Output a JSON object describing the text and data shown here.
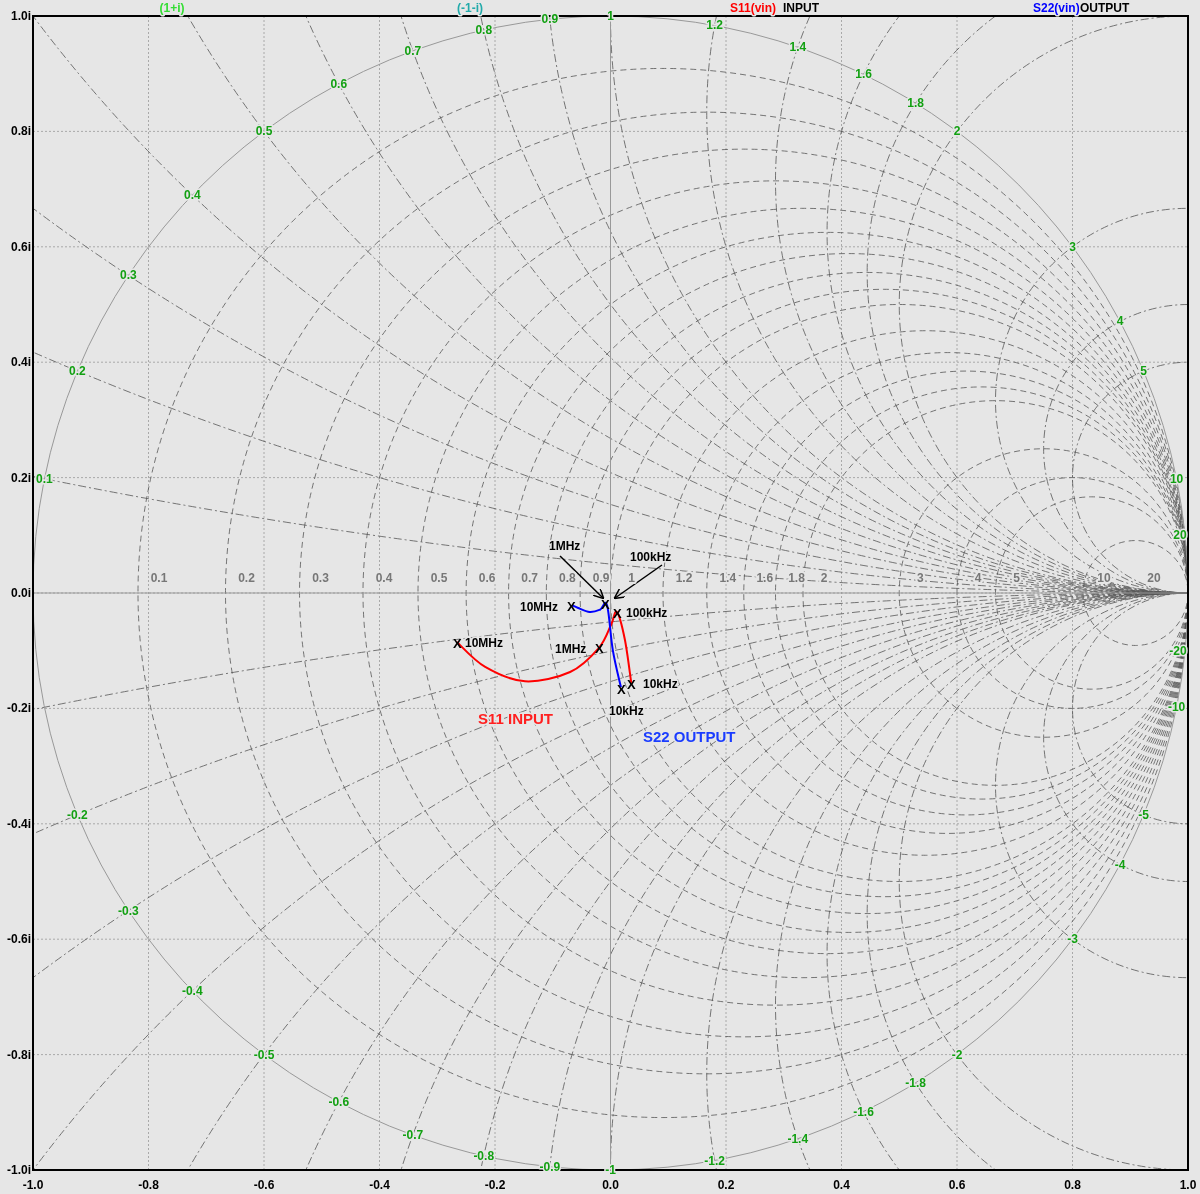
{
  "plot": {
    "reference_labels": [
      {
        "text": "(1+i)",
        "color": "#33dd33"
      },
      {
        "text": "(-1-i)",
        "color": "#22aaaa"
      }
    ],
    "legend": [
      {
        "label": "INPUT"
      },
      {
        "label": "OUTPUT"
      }
    ],
    "reactance_labels_upper": [
      "0.1",
      "0.2",
      "0.3",
      "0.4",
      "0.5",
      "0.6",
      "0.7",
      "0.8",
      "0.9",
      "1",
      "1.2",
      "1.4",
      "1.6",
      "1.8",
      "2",
      "3",
      "4",
      "5",
      "10",
      "20"
    ],
    "reactance_labels_lower": [
      "-0.2",
      "-0.3",
      "-0.4",
      "-0.5",
      "-0.6",
      "-0.7",
      "-0.8",
      "-0.9",
      "-1",
      "-1.2",
      "-1.4",
      "-1.6",
      "-1.8",
      "-2",
      "-3",
      "-4",
      "-5",
      "-10",
      "-20"
    ],
    "resistance_labels": [
      "0.1",
      "0.2",
      "0.3",
      "0.4",
      "0.5",
      "0.6",
      "0.7",
      "0.8",
      "0.9",
      "1",
      "1.2",
      "1.4",
      "1.6",
      "1.8",
      "2",
      "3",
      "4",
      "5",
      "10",
      "20"
    ],
    "chart_data": {
      "type": "line",
      "grid": true,
      "xlim": [
        -1,
        1
      ],
      "ylim": [
        -1,
        1
      ],
      "xticks": [
        {
          "value": -1,
          "label": "-1.0"
        },
        {
          "value": -0.8,
          "label": "-0.8"
        },
        {
          "value": -0.6,
          "label": "-0.6"
        },
        {
          "value": -0.4,
          "label": "-0.4"
        },
        {
          "value": -0.2,
          "label": "-0.2"
        },
        {
          "value": 0,
          "label": "0.0"
        },
        {
          "value": 0.2,
          "label": "0.2"
        },
        {
          "value": 0.4,
          "label": "0.4"
        },
        {
          "value": 0.6,
          "label": "0.6"
        },
        {
          "value": 0.8,
          "label": "0.8"
        },
        {
          "value": 1,
          "label": "1.0"
        }
      ],
      "yticks": [
        {
          "value": 1,
          "label": "1.0i"
        },
        {
          "value": 0.8,
          "label": "0.8i"
        },
        {
          "value": 0.6,
          "label": "0.6i"
        },
        {
          "value": 0.4,
          "label": "0.4i"
        },
        {
          "value": 0.2,
          "label": "0.2i"
        },
        {
          "value": 0,
          "label": "0.0i"
        },
        {
          "value": -0.2,
          "label": "-0.2i"
        },
        {
          "value": -0.4,
          "label": "-0.4i"
        },
        {
          "value": -0.6,
          "label": "-0.6i"
        },
        {
          "value": -0.8,
          "label": "-0.8i"
        },
        {
          "value": -1,
          "label": "-1.0i"
        }
      ],
      "series": [
        {
          "name": "S11(vin)",
          "color": "#ff0000",
          "x": [
            0.036,
            0.025,
            0.011,
            0.001,
            -0.02,
            -0.07,
            -0.148,
            -0.217,
            -0.266
          ],
          "values": [
            -0.156,
            -0.081,
            -0.033,
            -0.055,
            -0.095,
            -0.137,
            -0.153,
            -0.128,
            -0.085
          ]
        },
        {
          "name": "S22(vin)",
          "color": "#0000ff",
          "x": [
            0.018,
            0.004,
            -0.006,
            -0.018,
            -0.036,
            -0.056,
            -0.067
          ],
          "values": [
            -0.163,
            -0.099,
            -0.021,
            -0.029,
            -0.033,
            -0.026,
            -0.021
          ]
        }
      ]
    },
    "annotations": [
      {
        "kind": "callout",
        "text": "1MHz"
      },
      {
        "kind": "callout",
        "text": "100kHz"
      },
      {
        "kind": "label",
        "text": "10MHz"
      },
      {
        "kind": "marker",
        "text": "X"
      },
      {
        "kind": "marker",
        "text": "X"
      },
      {
        "kind": "marker",
        "text": "X"
      },
      {
        "kind": "label",
        "text": "100kHz"
      },
      {
        "kind": "marker",
        "text": "X"
      },
      {
        "kind": "label",
        "text": "10MHz"
      },
      {
        "kind": "label",
        "text": "1MHz"
      },
      {
        "kind": "marker",
        "text": "X"
      },
      {
        "kind": "marker",
        "text": "X"
      },
      {
        "kind": "label",
        "text": "10kHz"
      },
      {
        "kind": "marker",
        "text": "X"
      },
      {
        "kind": "label",
        "text": "10kHz"
      },
      {
        "kind": "title",
        "text": "S11 INPUT",
        "color": "#ff2020"
      },
      {
        "kind": "title",
        "text": "S22 OUTPUT",
        "color": "#1a3cff"
      }
    ]
  }
}
